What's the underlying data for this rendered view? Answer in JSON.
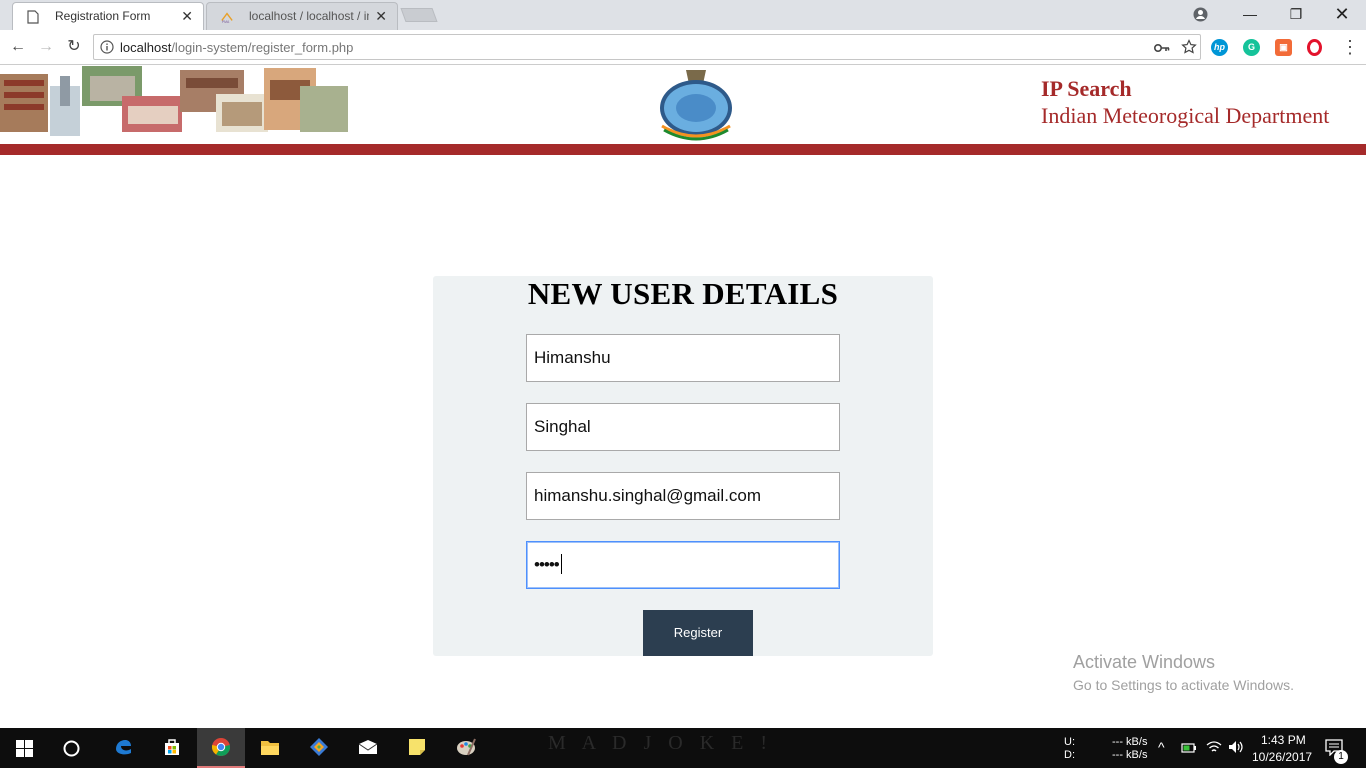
{
  "browser": {
    "tabs": [
      {
        "label": "Registration Form",
        "active": true
      },
      {
        "label": "localhost / localhost / im",
        "active": false
      }
    ],
    "url_host": "localhost",
    "url_path": "/login-system/register_form.php"
  },
  "header": {
    "title": "IP Search",
    "subtitle": "Indian Meteorogical Department"
  },
  "form": {
    "title": "NEW USER DETAILS",
    "first_name": "Himanshu",
    "last_name": "Singhal",
    "email": "himanshu.singhal@gmail.com",
    "password_mask": "•••••",
    "register_label": "Register"
  },
  "watermark": {
    "title": "Activate Windows",
    "subtitle": "Go to Settings to activate Windows."
  },
  "taskbar": {
    "net_up_label": "U:",
    "net_down_label": "D:",
    "net_up_value": "--- kB/s",
    "net_down_value": "--- kB/s",
    "time": "1:43 PM",
    "date": "10/26/2017",
    "notification_count": "1",
    "wallpaper_text": "M A D   J O K E !"
  },
  "colors": {
    "brand_red": "#a52a2a",
    "button_dark": "#2c3e50",
    "card_bg": "#eef2f3"
  }
}
